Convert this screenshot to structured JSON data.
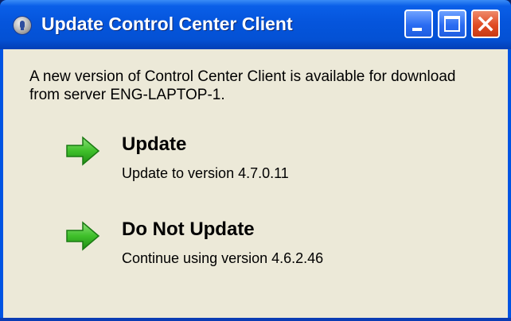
{
  "window": {
    "title": "Update Control Center Client",
    "app_icon": "app-info-icon",
    "controls": [
      "minimize-icon",
      "maximize-icon",
      "close-icon"
    ]
  },
  "message": "A new version of Control Center Client is available for download from server ENG-LAPTOP-1.",
  "options": [
    {
      "title": "Update",
      "description": "Update to version 4.7.0.11",
      "icon": "green-arrow-icon"
    },
    {
      "title": "Do Not Update",
      "description": "Continue using version 4.6.2.46",
      "icon": "green-arrow-icon"
    }
  ],
  "colors": {
    "title_bar": "#0555dc",
    "client_bg": "#ece9d8",
    "close_button": "#e04b23",
    "arrow": "#3fbf2a"
  }
}
